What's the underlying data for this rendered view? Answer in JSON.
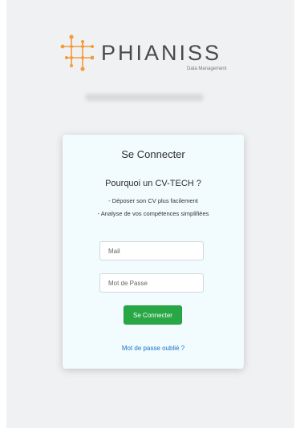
{
  "logo": {
    "wordmark": "PHIANISS",
    "tagline": "Data Management",
    "accent_color": "#f39c3c"
  },
  "login": {
    "title": "Se Connecter",
    "subtitle": "Pourquoi un CV-TECH ?",
    "bullets": [
      "- Déposer son CV plus facilement",
      "- Analyse de vos compétences simplifiées"
    ],
    "mail_placeholder": "Mail",
    "password_placeholder": "Mot de Passe",
    "submit_label": "Se Connecter",
    "forgot_link": "Mot de passe oublié ?",
    "button_color": "#28a745",
    "link_color": "#1a73c8"
  }
}
